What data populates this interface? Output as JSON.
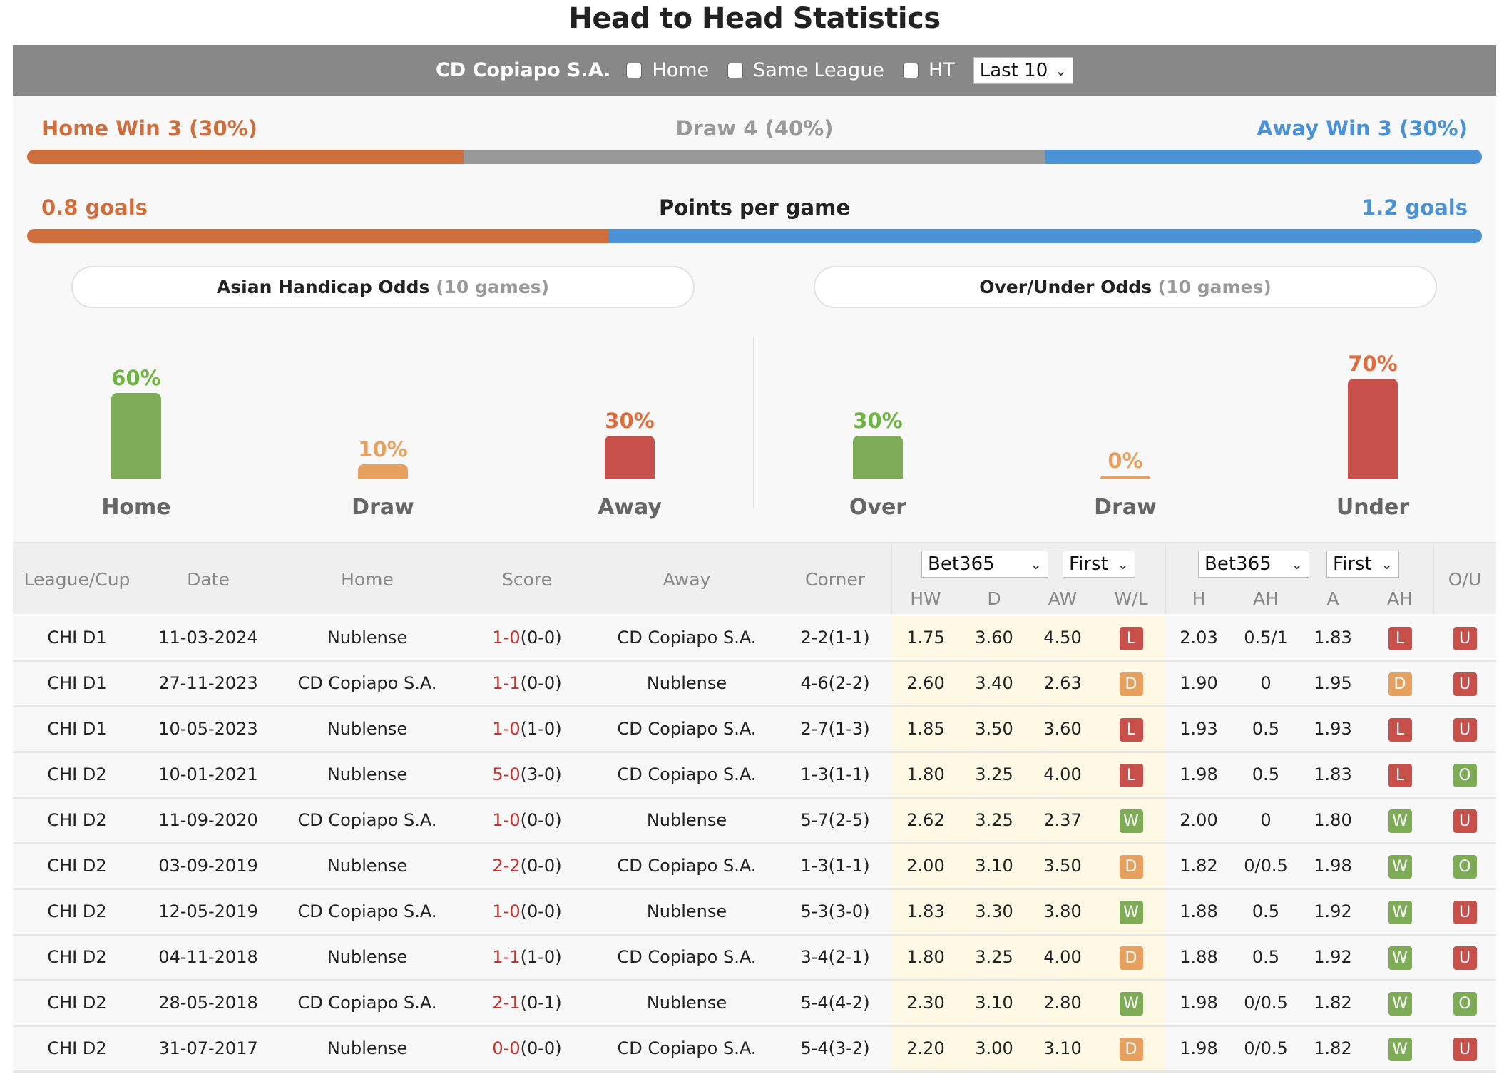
{
  "title": "Head to Head Statistics",
  "filters": {
    "team": "CD Copiapo S.A.",
    "checkboxes": [
      {
        "label": "Home",
        "checked": false
      },
      {
        "label": "Same League",
        "checked": false
      },
      {
        "label": "HT",
        "checked": false
      }
    ],
    "range_select": "Last 10"
  },
  "results": {
    "home_label": "Home Win 3 (30%)",
    "draw_label": "Draw 4 (40%)",
    "away_label": "Away Win 3 (30%)",
    "home_pct": 30,
    "draw_pct": 40,
    "away_pct": 30
  },
  "goals": {
    "home_label": "0.8 goals",
    "center_label": "Points per game",
    "away_label": "1.2 goals",
    "home_value": 0.8,
    "away_value": 1.2
  },
  "colors": {
    "home": "#cf6e3d",
    "draw": "#999999",
    "away": "#4a92d4",
    "green": "#7eab55",
    "orange": "#e6a15f",
    "red": "#c8504a"
  },
  "asian_handicap": {
    "title": "Asian Handicap Odds",
    "games": "(10 games)",
    "items": [
      {
        "name": "Home",
        "pct_label": "60%",
        "pct": 60,
        "color": "#7eab55",
        "text_color": "#6db33f"
      },
      {
        "name": "Draw",
        "pct_label": "10%",
        "pct": 10,
        "color": "#e6a15f",
        "text_color": "#e6a15f"
      },
      {
        "name": "Away",
        "pct_label": "30%",
        "pct": 30,
        "color": "#c8504a",
        "text_color": "#e06c3e"
      }
    ]
  },
  "over_under": {
    "title": "Over/Under Odds",
    "games": "(10 games)",
    "items": [
      {
        "name": "Over",
        "pct_label": "30%",
        "pct": 30,
        "color": "#7eab55",
        "text_color": "#6db33f"
      },
      {
        "name": "Draw",
        "pct_label": "0%",
        "pct": 0,
        "color": "#e6a15f",
        "text_color": "#e6a15f"
      },
      {
        "name": "Under",
        "pct_label": "70%",
        "pct": 70,
        "color": "#c8504a",
        "text_color": "#e06c3e"
      }
    ]
  },
  "table": {
    "headers": {
      "league": "League/Cup",
      "date": "Date",
      "home": "Home",
      "score": "Score",
      "away": "Away",
      "corner": "Corner",
      "ou": "O/U"
    },
    "odds_1x2": {
      "bookmaker": "Bet365",
      "type": "First",
      "cols": [
        "HW",
        "D",
        "AW",
        "W/L"
      ]
    },
    "odds_ah": {
      "bookmaker": "Bet365",
      "type": "First",
      "cols": [
        "H",
        "AH",
        "A",
        "AH"
      ]
    },
    "rows": [
      {
        "league": "CHI D1",
        "date": "11-03-2024",
        "home": "Nublense",
        "home_hl": false,
        "score": "1-0",
        "ht": "(0-0)",
        "away": "CD Copiapo S.A.",
        "away_hl": true,
        "corner": "2-2(1-1)",
        "hw": "1.75",
        "d": "3.60",
        "aw": "4.50",
        "wl": "L",
        "h": "2.03",
        "ah": "0.5/1",
        "a": "1.83",
        "ahr": "L",
        "ou": "U"
      },
      {
        "league": "CHI D1",
        "date": "27-11-2023",
        "home": "CD Copiapo S.A.",
        "home_hl": true,
        "score": "1-1",
        "ht": "(0-0)",
        "away": "Nublense",
        "away_hl": false,
        "corner": "4-6(2-2)",
        "hw": "2.60",
        "d": "3.40",
        "aw": "2.63",
        "wl": "D",
        "h": "1.90",
        "ah": "0",
        "a": "1.95",
        "ahr": "D",
        "ou": "U"
      },
      {
        "league": "CHI D1",
        "date": "10-05-2023",
        "home": "Nublense",
        "home_hl": false,
        "score": "1-0",
        "ht": "(1-0)",
        "away": "CD Copiapo S.A.",
        "away_hl": true,
        "corner": "2-7(1-3)",
        "hw": "1.85",
        "d": "3.50",
        "aw": "3.60",
        "wl": "L",
        "h": "1.93",
        "ah": "0.5",
        "a": "1.93",
        "ahr": "L",
        "ou": "U"
      },
      {
        "league": "CHI D2",
        "date": "10-01-2021",
        "home": "Nublense",
        "home_hl": false,
        "score": "5-0",
        "ht": "(3-0)",
        "away": "CD Copiapo S.A.",
        "away_hl": true,
        "corner": "1-3(1-1)",
        "hw": "1.80",
        "d": "3.25",
        "aw": "4.00",
        "wl": "L",
        "h": "1.98",
        "ah": "0.5",
        "a": "1.83",
        "ahr": "L",
        "ou": "O"
      },
      {
        "league": "CHI D2",
        "date": "11-09-2020",
        "home": "CD Copiapo S.A.",
        "home_hl": true,
        "score": "1-0",
        "ht": "(0-0)",
        "away": "Nublense",
        "away_hl": false,
        "corner": "5-7(2-5)",
        "hw": "2.62",
        "d": "3.25",
        "aw": "2.37",
        "wl": "W",
        "h": "2.00",
        "ah": "0",
        "a": "1.80",
        "ahr": "W",
        "ou": "U"
      },
      {
        "league": "CHI D2",
        "date": "03-09-2019",
        "home": "Nublense",
        "home_hl": false,
        "score": "2-2",
        "ht": "(0-0)",
        "away": "CD Copiapo S.A.",
        "away_hl": true,
        "corner": "1-3(1-1)",
        "hw": "2.00",
        "d": "3.10",
        "aw": "3.50",
        "wl": "D",
        "h": "1.82",
        "ah": "0/0.5",
        "a": "1.98",
        "ahr": "W",
        "ou": "O"
      },
      {
        "league": "CHI D2",
        "date": "12-05-2019",
        "home": "CD Copiapo S.A.",
        "home_hl": true,
        "score": "1-0",
        "ht": "(0-0)",
        "away": "Nublense",
        "away_hl": false,
        "corner": "5-3(3-0)",
        "hw": "1.83",
        "d": "3.30",
        "aw": "3.80",
        "wl": "W",
        "h": "1.88",
        "ah": "0.5",
        "a": "1.92",
        "ahr": "W",
        "ou": "U"
      },
      {
        "league": "CHI D2",
        "date": "04-11-2018",
        "home": "Nublense",
        "home_hl": false,
        "score": "1-1",
        "ht": "(1-0)",
        "away": "CD Copiapo S.A.",
        "away_hl": true,
        "corner": "3-4(2-1)",
        "hw": "1.80",
        "d": "3.25",
        "aw": "4.00",
        "wl": "D",
        "h": "1.88",
        "ah": "0.5",
        "a": "1.92",
        "ahr": "W",
        "ou": "U"
      },
      {
        "league": "CHI D2",
        "date": "28-05-2018",
        "home": "CD Copiapo S.A.",
        "home_hl": true,
        "score": "2-1",
        "ht": "(0-1)",
        "away": "Nublense",
        "away_hl": false,
        "corner": "5-4(4-2)",
        "hw": "2.30",
        "d": "3.10",
        "aw": "2.80",
        "wl": "W",
        "h": "1.98",
        "ah": "0/0.5",
        "a": "1.82",
        "ahr": "W",
        "ou": "O"
      },
      {
        "league": "CHI D2",
        "date": "31-07-2017",
        "home": "Nublense",
        "home_hl": false,
        "score": "0-0",
        "ht": "(0-0)",
        "away": "CD Copiapo S.A.",
        "away_hl": true,
        "corner": "5-4(3-2)",
        "hw": "2.20",
        "d": "3.00",
        "aw": "3.10",
        "wl": "D",
        "h": "1.98",
        "ah": "0/0.5",
        "a": "1.82",
        "ahr": "W",
        "ou": "U"
      }
    ]
  }
}
